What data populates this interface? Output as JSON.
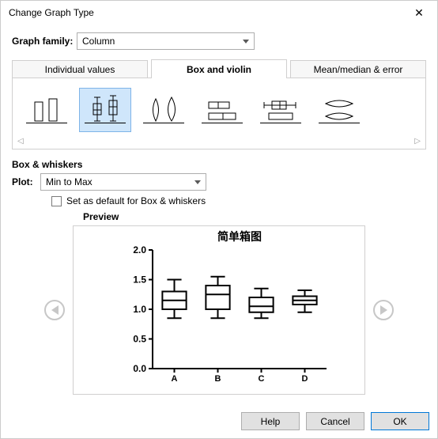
{
  "window": {
    "title": "Change Graph Type"
  },
  "family": {
    "label": "Graph family:",
    "value": "Column"
  },
  "tabs": [
    {
      "label": "Individual values"
    },
    {
      "label": "Box and violin"
    },
    {
      "label": "Mean/median & error"
    }
  ],
  "active_tab_index": 1,
  "section": {
    "title": "Box & whiskers",
    "plot_label": "Plot:",
    "plot_value": "Min to Max",
    "default_check_label": "Set as default for Box & whiskers",
    "preview_label": "Preview"
  },
  "buttons": {
    "help": "Help",
    "cancel": "Cancel",
    "ok": "OK"
  },
  "chart_data": {
    "type": "boxwhisker",
    "title": "简单箱图",
    "xlabel": "",
    "ylabel": "",
    "ylim": [
      0.0,
      2.0
    ],
    "yticks": [
      0.0,
      0.5,
      1.0,
      1.5,
      2.0
    ],
    "categories": [
      "A",
      "B",
      "C",
      "D"
    ],
    "series": [
      {
        "name": "A",
        "min": 0.85,
        "q1": 1.0,
        "median": 1.15,
        "q3": 1.3,
        "max": 1.5
      },
      {
        "name": "B",
        "min": 0.85,
        "q1": 1.0,
        "median": 1.25,
        "q3": 1.4,
        "max": 1.55
      },
      {
        "name": "C",
        "min": 0.85,
        "q1": 0.95,
        "median": 1.05,
        "q3": 1.2,
        "max": 1.35
      },
      {
        "name": "D",
        "min": 0.95,
        "q1": 1.08,
        "median": 1.15,
        "q3": 1.22,
        "max": 1.32
      }
    ]
  },
  "type_icons": [
    "bars-thin",
    "box-vertical",
    "violin",
    "box-horizontal",
    "box-hwhisker",
    "violin-horizontal"
  ],
  "selected_type_index": 1
}
